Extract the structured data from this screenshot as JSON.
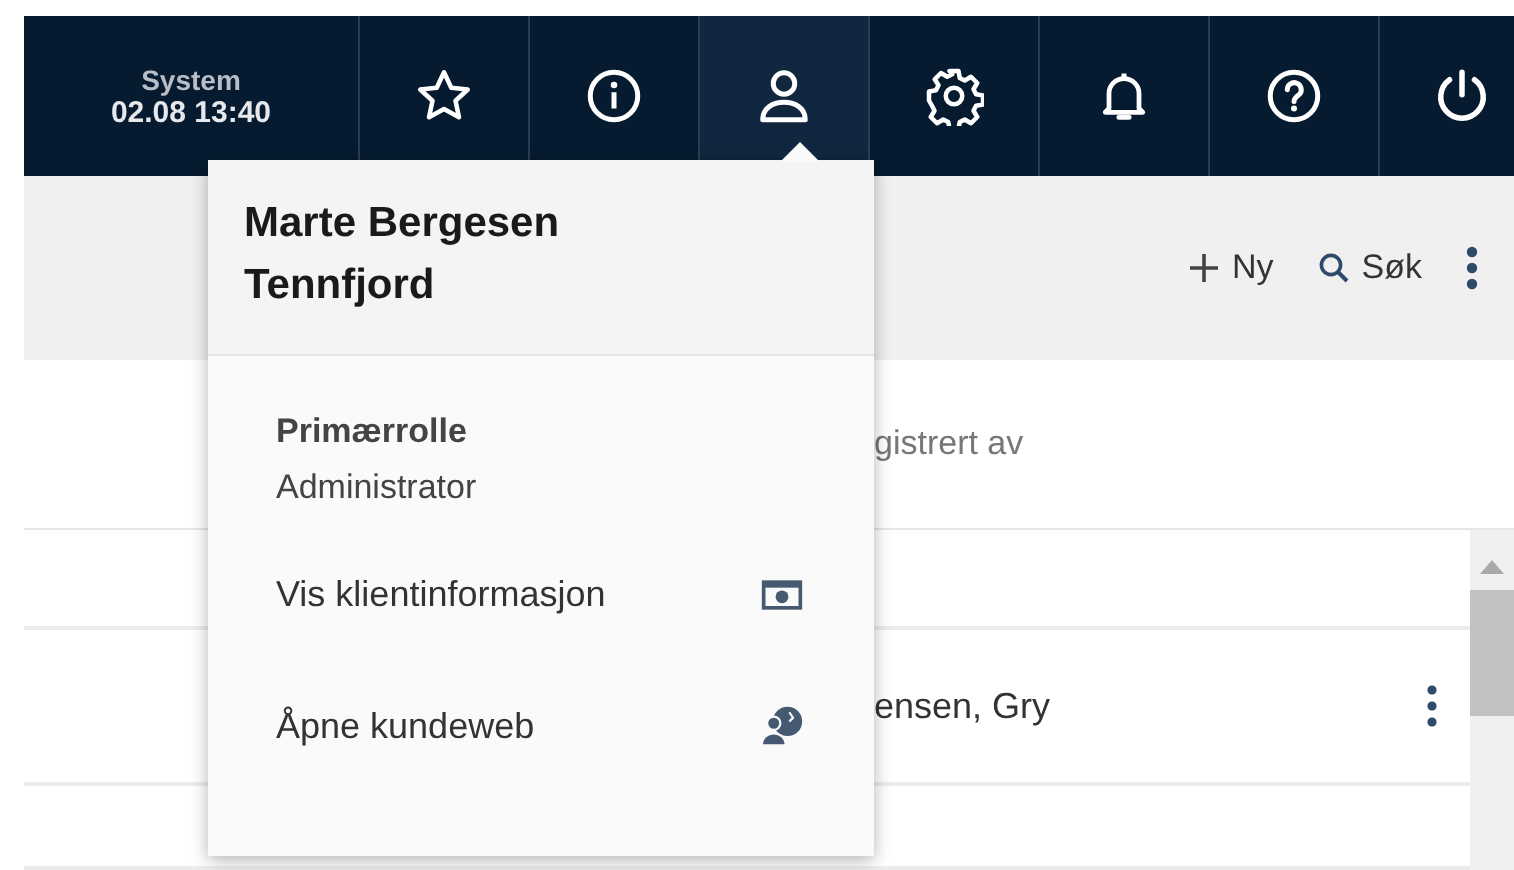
{
  "topbar": {
    "system_label": "System",
    "datetime": "02.08 13:40",
    "items": [
      {
        "kind": "star",
        "selected": false
      },
      {
        "kind": "info",
        "selected": false
      },
      {
        "kind": "user",
        "selected": true
      },
      {
        "kind": "gear",
        "selected": false
      },
      {
        "kind": "bell",
        "selected": false
      },
      {
        "kind": "help",
        "selected": false
      },
      {
        "kind": "power",
        "selected": false
      }
    ]
  },
  "toolbar": {
    "buttons": [
      {
        "kind": "new",
        "label": "Ny"
      },
      {
        "kind": "search",
        "label": "Søk"
      }
    ]
  },
  "table": {
    "header": "gistrert av",
    "rows": [
      {
        "cell": ""
      },
      {
        "cell": "ensen, Gry"
      },
      {
        "cell": ""
      }
    ]
  },
  "user_menu": {
    "name": "Marte Bergesen Tennfjord",
    "role_label": "Primærrolle",
    "role": "Administrator",
    "items": [
      {
        "kind": "client-info",
        "label": "Vis klientinformasjon"
      },
      {
        "kind": "customer-web",
        "label": "Åpne kundeweb"
      }
    ]
  }
}
